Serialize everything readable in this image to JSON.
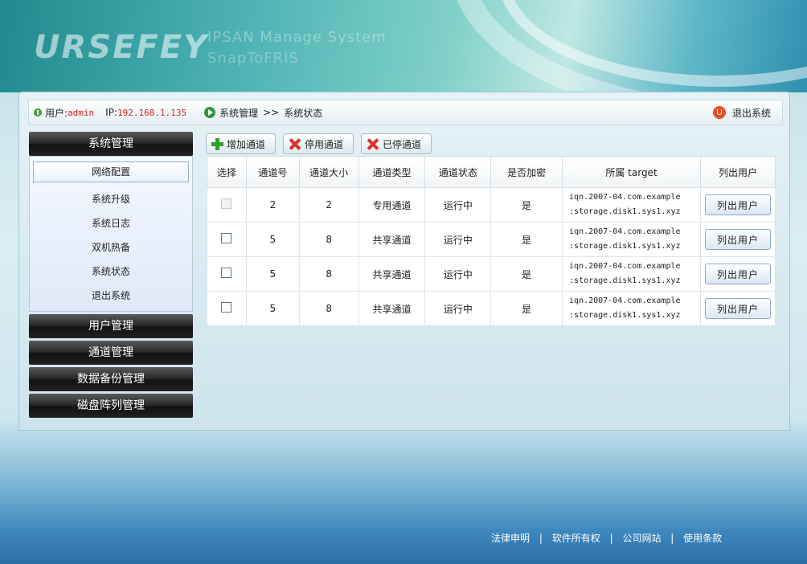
{
  "banner": {
    "logo_text": "URSEFEY",
    "subtitle1": "IPSAN Manage System",
    "subtitle2": "SnapToFRIS"
  },
  "topbar": {
    "user_label": "用户:",
    "user_name": "admin",
    "ip_label": "IP:",
    "ip_value": "192.168.1.135",
    "breadcrumb_section": "系统管理",
    "breadcrumb_sep": ">>",
    "breadcrumb_page": "系统状态",
    "logout_label": "退出系统"
  },
  "sidebar": {
    "system_menu": {
      "title": "系统管理",
      "items": [
        "网络配置",
        "系统升级",
        "系统日志",
        "双机热备",
        "系统状态",
        "退出系统"
      ]
    },
    "user_menu": "用户管理",
    "channel_menu": "通道管理",
    "backup_menu": "数据备份管理",
    "raid_menu": "磁盘阵列管理"
  },
  "toolbar": {
    "add": "增加通道",
    "disable": "停用通道",
    "stopped": "已停通道"
  },
  "table": {
    "headers": [
      "选择",
      "通道号",
      "通道大小",
      "通道类型",
      "通道状态",
      "是否加密",
      "所属 target",
      "列出用户"
    ],
    "rows": [
      {
        "channel": "2",
        "size": "2",
        "type": "专用通道",
        "status": "运行中",
        "encrypted": "是",
        "target1": "iqn.2007-04.com.example",
        "target2": ":storage.disk1.sys1.xyz",
        "button": "列出用户"
      },
      {
        "channel": "5",
        "size": "8",
        "type": "共享通道",
        "status": "运行中",
        "encrypted": "是",
        "target1": "iqn.2007-04.com.example",
        "target2": ":storage.disk1.sys1.xyz",
        "button": "列出用户"
      },
      {
        "channel": "5",
        "size": "8",
        "type": "共享通道",
        "status": "运行中",
        "encrypted": "是",
        "target1": "iqn.2007-04.com.example",
        "target2": ":storage.disk1.sys1.xyz",
        "button": "列出用户"
      },
      {
        "channel": "5",
        "size": "8",
        "type": "共享通道",
        "status": "运行中",
        "encrypted": "是",
        "target1": "iqn.2007-04.com.example",
        "target2": ":storage.disk1.sys1.xyz",
        "button": "列出用户"
      }
    ]
  },
  "footer": {
    "legal": "法律申明",
    "copyright": "软件所有权",
    "site": "公司网站",
    "terms": "使用条款",
    "sep": "|"
  }
}
